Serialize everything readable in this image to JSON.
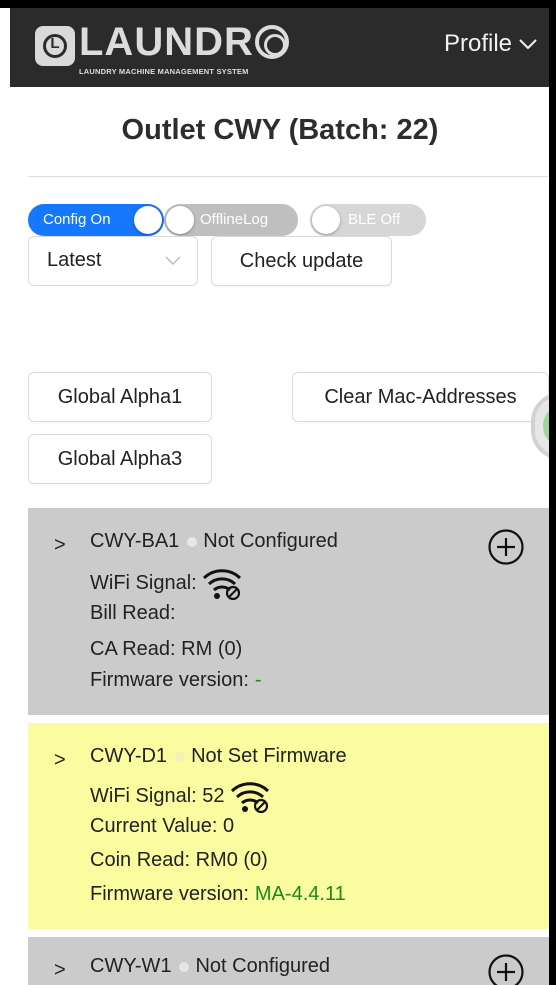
{
  "header": {
    "logo_text_1": "LAUNDR",
    "logo_subtitle": "LAUNDRY MACHINE MANAGEMENT SYSTEM",
    "profile_label": "Profile"
  },
  "title": "Outlet CWY (Batch: 22)",
  "toggles": {
    "config": "Config On",
    "offline": "OfflineLog",
    "ble": "BLE Off"
  },
  "version_select": {
    "value": "Latest"
  },
  "buttons": {
    "check_update": "Check update",
    "global_alpha1": "Global Alpha1",
    "clear_mac": "Clear Mac-Addresses",
    "global_alpha3": "Global Alpha3"
  },
  "machines": [
    {
      "name": "CWY-BA1",
      "status": "Not Configured",
      "wifi_label": "WiFi Signal:",
      "wifi_value": "",
      "line3": "Bill Read:",
      "line4": "CA Read: RM (0)",
      "firmware_label": "Firmware version:",
      "firmware_value": "-",
      "bg": "#cbcbcb"
    },
    {
      "name": "CWY-D1",
      "status": "Not Set Firmware",
      "wifi_label": "WiFi Signal: 52",
      "line3": "Current Value: 0",
      "line4": "Coin Read: RM0 (0)",
      "firmware_label": "Firmware version:",
      "firmware_value": "MA-4.4.11",
      "bg": "#fbfba0"
    },
    {
      "name": "CWY-W1",
      "status": "Not Configured",
      "bg": "#cbcbcb"
    }
  ],
  "colors": {
    "accent": "#1677ff",
    "header_bg": "#2b2b2b",
    "firmware_green": "#1a8a1a"
  },
  "icons": [
    "logo-icon",
    "chevron-down-icon",
    "chevron-right-icon",
    "wifi-off-icon",
    "add-circle-icon"
  ]
}
